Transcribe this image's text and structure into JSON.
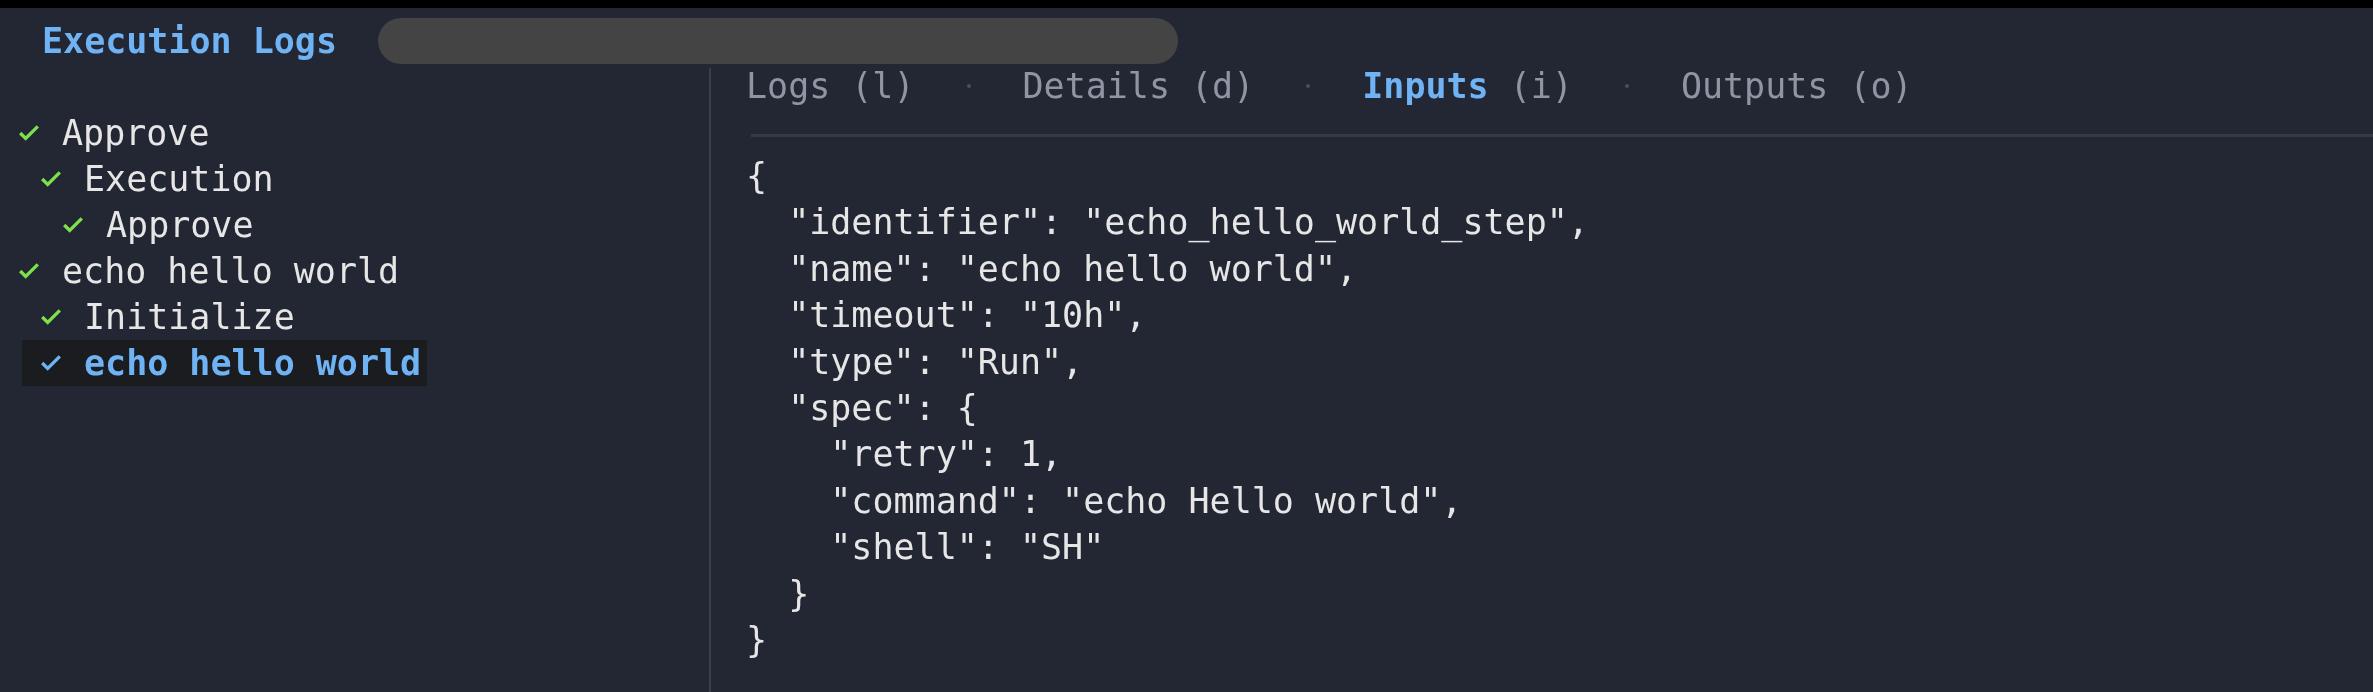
{
  "header": {
    "title": "Execution Logs"
  },
  "tree": [
    {
      "label": "Approve",
      "done": true,
      "selected": false,
      "children": [
        {
          "label": "Execution",
          "done": true,
          "selected": false,
          "children": [
            {
              "label": "Approve",
              "done": true,
              "selected": false
            }
          ]
        }
      ]
    },
    {
      "label": "echo hello world",
      "done": true,
      "selected": false,
      "children": [
        {
          "label": "Initialize",
          "done": true,
          "selected": false
        },
        {
          "label": "echo hello world",
          "done": true,
          "selected": true
        }
      ]
    }
  ],
  "tabs": [
    {
      "label": "Logs",
      "key": "(l)",
      "selected": false
    },
    {
      "label": "Details",
      "key": "(d)",
      "selected": false
    },
    {
      "label": "Inputs",
      "key": "(i)",
      "selected": true
    },
    {
      "label": "Outputs",
      "key": "(o)",
      "selected": false
    }
  ],
  "code_lines": [
    "{",
    "  \"identifier\": \"echo_hello_world_step\",",
    "  \"name\": \"echo hello world\",",
    "  \"timeout\": \"10h\",",
    "  \"type\": \"Run\",",
    "  \"spec\": {",
    "    \"retry\": 1,",
    "    \"command\": \"echo Hello world\",",
    "    \"shell\": \"SH\"",
    "  }",
    "}"
  ]
}
